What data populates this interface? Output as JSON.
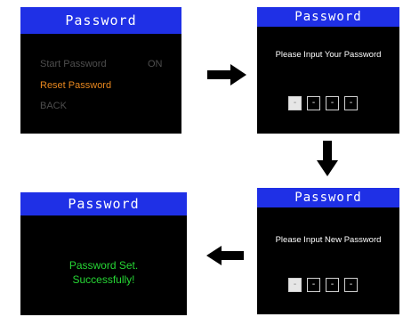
{
  "screens": [
    {
      "title": "Password",
      "menu": [
        {
          "label": "Start Password",
          "value": "ON",
          "selected": false
        },
        {
          "label": "Reset Password",
          "value": "",
          "selected": true
        },
        {
          "label": "BACK",
          "value": "",
          "selected": false
        }
      ]
    },
    {
      "title": "Password",
      "prompt": "Please Input Your Password",
      "digits": [
        "-",
        "-",
        "-",
        "-"
      ]
    },
    {
      "title": "Password",
      "prompt": "Please Input New Password",
      "digits": [
        "-",
        "-",
        "-",
        "-"
      ]
    },
    {
      "title": "Password",
      "message": [
        "Password Set.",
        "Successfully!"
      ]
    }
  ],
  "colors": {
    "title_bar": "#1f30e6",
    "screen_bg": "#000000",
    "selected_item": "#e8871e",
    "dim_item": "#4e4e4e",
    "success_text": "#26d634"
  },
  "arrows": [
    "arrow-right",
    "arrow-down",
    "arrow-left"
  ]
}
